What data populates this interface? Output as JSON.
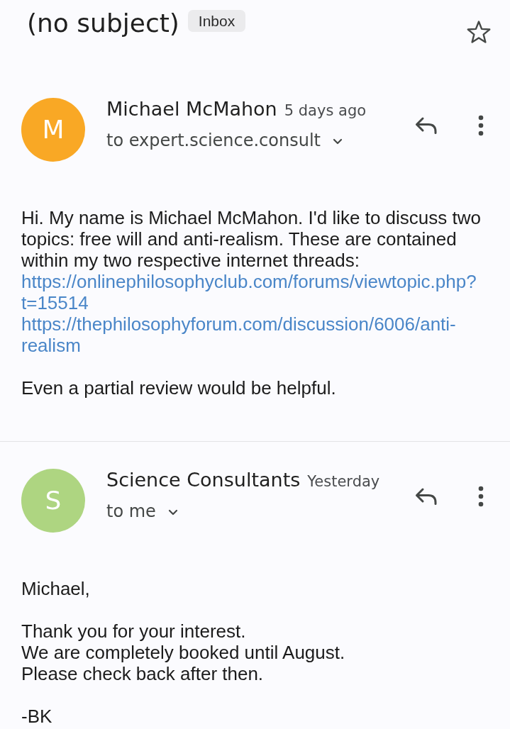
{
  "subject": {
    "title": "(no subject)",
    "label": "Inbox",
    "starred": false
  },
  "messages": [
    {
      "avatar": {
        "letter": "M",
        "color": "#f9a825"
      },
      "sender": "Michael McMahon",
      "time": "5 days ago",
      "recipient": "to expert.science.consult",
      "body": [
        {
          "lines": [
            {
              "kind": "text",
              "text": "Hi. My name is Michael McMahon. I'd like to discuss two topics: free will and anti-realism. These are contained within my two respective internet threads:"
            },
            {
              "kind": "link",
              "text": "https://onlinephilosophyclub.com/forums/viewtopic.php?t=15514"
            },
            {
              "kind": "link",
              "text": "https://thephilosophyforum.com/discussion/6006/anti-realism"
            }
          ]
        },
        {
          "lines": [
            {
              "kind": "text",
              "text": "Even a partial review would be helpful."
            }
          ]
        }
      ]
    },
    {
      "avatar": {
        "letter": "S",
        "color": "#aed581"
      },
      "sender": "Science Consultants",
      "time": "Yesterday",
      "recipient": "to me",
      "body": [
        {
          "lines": [
            {
              "kind": "text",
              "text": "Michael,"
            }
          ]
        },
        {
          "lines": [
            {
              "kind": "text",
              "text": "Thank you for your interest."
            },
            {
              "kind": "text",
              "text": "We are completely booked until August."
            },
            {
              "kind": "text",
              "text": "Please check back after then."
            }
          ]
        },
        {
          "lines": [
            {
              "kind": "text",
              "text": "-BK"
            }
          ]
        }
      ]
    }
  ]
}
